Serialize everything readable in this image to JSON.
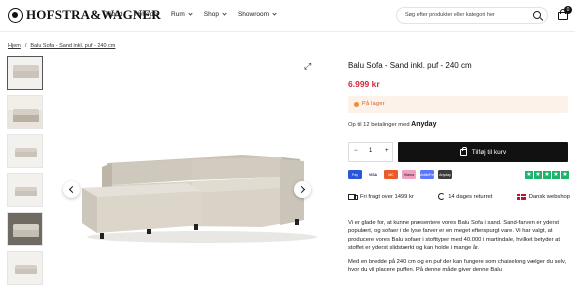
{
  "header": {
    "brand": "HOFSTRA&WAGNER",
    "nav": [
      {
        "label": "Tilbud",
        "has_dropdown": false
      },
      {
        "label": "Nyheder",
        "has_dropdown": false
      },
      {
        "label": "Rum",
        "has_dropdown": true
      },
      {
        "label": "Shop",
        "has_dropdown": true
      },
      {
        "label": "Showroom",
        "has_dropdown": true
      }
    ],
    "search_placeholder": "Søg efter produkter eller kategori her",
    "cart_count": "0"
  },
  "breadcrumb": {
    "home": "Hjem",
    "separator": "/",
    "current": "Balu Sofa - Sand inkl. puf - 240 cm"
  },
  "product": {
    "title": "Balu Sofa - Sand inkl. puf - 240 cm",
    "price": "6.999 kr",
    "stock_status": "På lager",
    "installment_text": "Op til 12 betalinger med",
    "installment_provider": "Anyday",
    "quantity": "1",
    "qty_minus": "−",
    "qty_plus": "+",
    "add_to_cart": "Tilføj til kurv",
    "payment_methods": [
      {
        "name": "ApplePay",
        "label": "Pay",
        "color": "#2a56d8"
      },
      {
        "name": "Visa",
        "label": "VISA",
        "color": "#1a1f71"
      },
      {
        "name": "Mastercard",
        "label": "MC",
        "color": "#eb5a2b"
      },
      {
        "name": "Klarna",
        "label": "Klarna",
        "color": "#f3a0c0"
      },
      {
        "name": "MobilePay",
        "label": "MobilePay",
        "color": "#5a78ff"
      },
      {
        "name": "Anyday",
        "label": "Anyday",
        "color": "#3b3b3b"
      }
    ],
    "rating_color": "#1fb26b",
    "benefits": [
      {
        "icon": "truck-icon",
        "label": "Fri fragt over 1499 kr"
      },
      {
        "icon": "return-icon",
        "label": "14 dages returret"
      },
      {
        "icon": "flag-icon",
        "label": "Dansk webshop"
      }
    ],
    "description": [
      "Vi er glade for, at kunne præsentere vores Balu Sofa i sand. Sand-farven er yderst populært, og sofaer i de lyse farver er en meget efterspurgt vare. Vi har valgt, at producere vores Balu sofaer i stofttyper med 40.000 i martindale, hvilket betyder at stoffet er yderst slidstærkt og kan holde i mange år.",
      "Med en bredde på 240 cm og en puf der kan fungere som chaiselong vælger du selv, hvor du vil placere puffen. På denne måde giver denne Balu"
    ]
  },
  "colors": {
    "price": "#d6273a",
    "stock_bg": "#fdf2e9",
    "stock_text": "#c55e1f",
    "button": "#111111"
  }
}
